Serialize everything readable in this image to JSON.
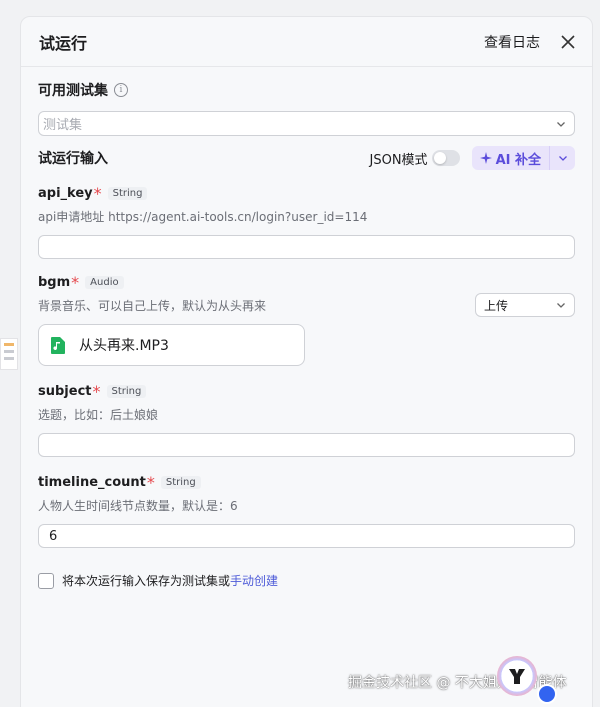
{
  "header": {
    "title": "试运行",
    "log_label": "查看日志"
  },
  "test_set": {
    "label": "可用测试集",
    "placeholder": "测试集"
  },
  "run_input": {
    "label": "试运行输入",
    "json_mode_label": "JSON模式",
    "json_mode_on": false,
    "ai_fill_label": "AI 补全"
  },
  "fields": {
    "api_key": {
      "name": "api_key",
      "required": "*",
      "type": "String",
      "desc": "api申请地址 https://agent.ai-tools.cn/login?user_id=114",
      "value": ""
    },
    "bgm": {
      "name": "bgm",
      "required": "*",
      "type": "Audio",
      "desc": "背景音乐、可以自己上传，默认为从头再来",
      "mode": "上传",
      "file_name": "从头再来.MP3"
    },
    "subject": {
      "name": "subject",
      "required": "*",
      "type": "String",
      "desc": "选题，比如：后土娘娘",
      "value": ""
    },
    "timeline_count": {
      "name": "timeline_count",
      "required": "*",
      "type": "String",
      "desc": "人物人生时间线节点数量，默认是：6",
      "value": "6"
    }
  },
  "save": {
    "checked": false,
    "label": "将本次运行输入保存为测试集或",
    "link": "手动创建"
  },
  "watermark": "掘金技术社区 @ 不大姐姐AI智能体",
  "colors": {
    "accent": "#5b4cdb",
    "link": "#4e5bd8",
    "required": "#e5484d",
    "audio_file": "#22b35e"
  }
}
